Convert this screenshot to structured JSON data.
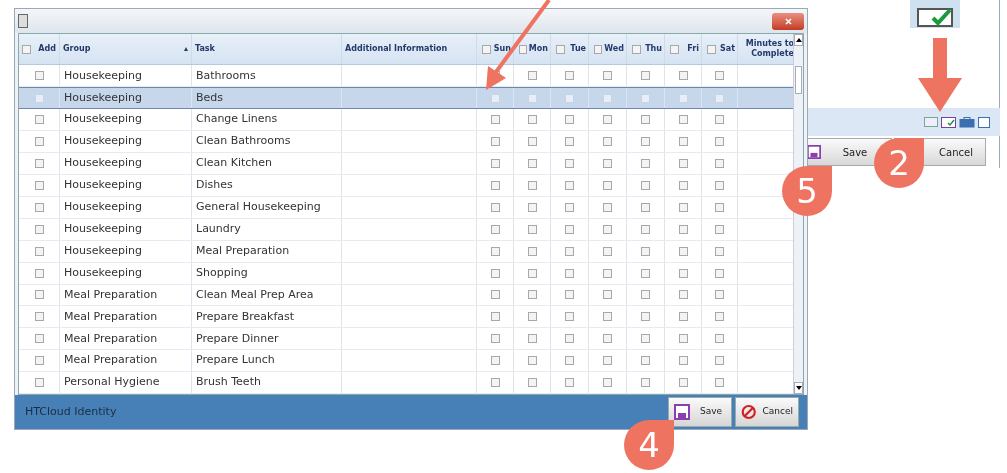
{
  "dialog": {
    "columns": [
      {
        "label": "Add",
        "kind": "check",
        "checked": false
      },
      {
        "label": "Group",
        "kind": "sort"
      },
      {
        "label": "Task",
        "kind": "text"
      },
      {
        "label": "Additional Information",
        "kind": "text"
      },
      {
        "label": "Sun",
        "kind": "check",
        "checked": false
      },
      {
        "label": "Mon",
        "kind": "check",
        "checked": false
      },
      {
        "label": "Tue",
        "kind": "check",
        "checked": false
      },
      {
        "label": "Wed",
        "kind": "check",
        "checked": false
      },
      {
        "label": "Thu",
        "kind": "check",
        "checked": false
      },
      {
        "label": "Fri",
        "kind": "check",
        "checked": false
      },
      {
        "label": "Sat",
        "kind": "check",
        "checked": false
      },
      {
        "label": "Minutes to Complete",
        "kind": "text"
      }
    ],
    "rows": [
      {
        "group": "Housekeeping",
        "task": "Bathrooms",
        "selected": false
      },
      {
        "group": "Housekeeping",
        "task": "Beds",
        "selected": true
      },
      {
        "group": "Housekeeping",
        "task": "Change Linens",
        "selected": false
      },
      {
        "group": "Housekeeping",
        "task": "Clean Bathrooms",
        "selected": false
      },
      {
        "group": "Housekeeping",
        "task": "Clean Kitchen",
        "selected": false
      },
      {
        "group": "Housekeeping",
        "task": "Dishes",
        "selected": false
      },
      {
        "group": "Housekeeping",
        "task": "General Housekeeping",
        "selected": false
      },
      {
        "group": "Housekeeping",
        "task": "Laundry",
        "selected": false
      },
      {
        "group": "Housekeeping",
        "task": "Meal Preparation",
        "selected": false
      },
      {
        "group": "Housekeeping",
        "task": "Shopping",
        "selected": false
      },
      {
        "group": "Meal Preparation",
        "task": "Clean Meal Prep Area",
        "selected": false
      },
      {
        "group": "Meal Preparation",
        "task": "Prepare Breakfast",
        "selected": false
      },
      {
        "group": "Meal Preparation",
        "task": "Prepare Dinner",
        "selected": false
      },
      {
        "group": "Meal Preparation",
        "task": "Prepare Lunch",
        "selected": false
      },
      {
        "group": "Personal Hygiene",
        "task": "Brush Teeth",
        "selected": false
      }
    ],
    "footer": {
      "label": "HTCloud Identity"
    },
    "buttons": [
      {
        "kind": "save",
        "label": "Save"
      },
      {
        "kind": "cancel",
        "label": "Cancel"
      }
    ]
  },
  "background_window": {
    "buttons": [
      {
        "kind": "save",
        "label": "Save"
      },
      {
        "kind": "cancel",
        "label": "Cancel"
      }
    ]
  },
  "callouts": [
    {
      "label": "5"
    },
    {
      "label": "2"
    },
    {
      "label": "4"
    }
  ]
}
